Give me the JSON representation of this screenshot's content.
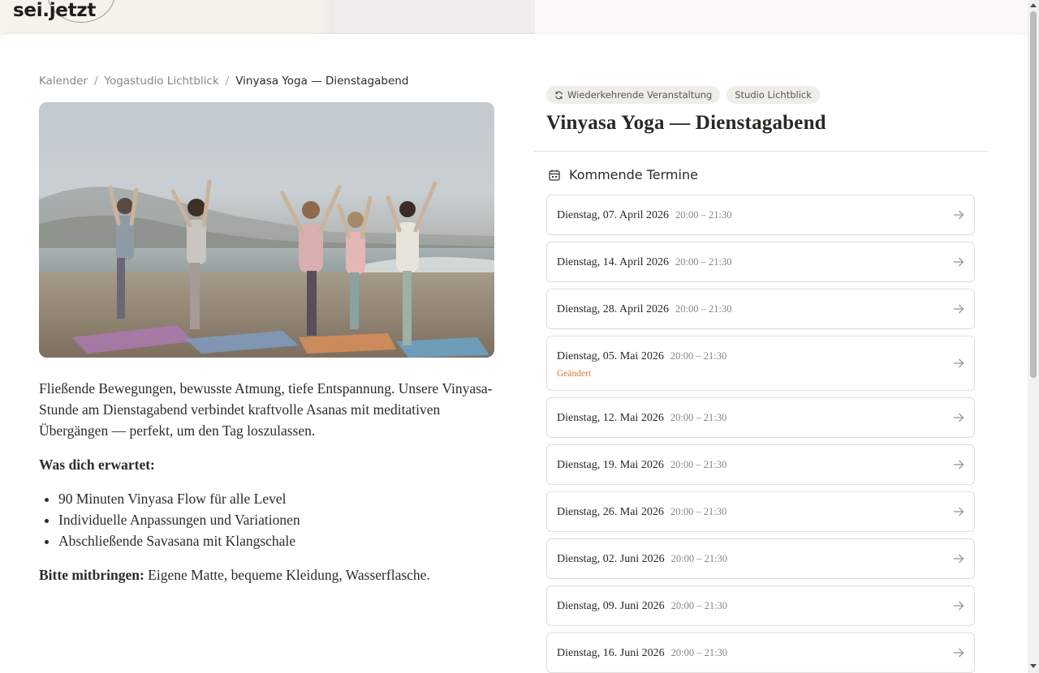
{
  "header": {
    "logo_text": "sei.jetzt"
  },
  "breadcrumb": {
    "items": [
      "Kalender",
      "Yogastudio Lichtblick",
      "Vinyasa Yoga — Dienstagabend"
    ],
    "separator": "/"
  },
  "event": {
    "chips": [
      "Wiederkehrende Veranstaltung",
      "Studio Lichtblick"
    ],
    "title": "Vinyasa Yoga — Dienstagabend",
    "upcoming_heading": "Kommende Termine",
    "changed_label": "Geändert",
    "dates": [
      {
        "day": "Dienstag, 07. April 2026",
        "time": "20:00 – 21:30",
        "changed": false
      },
      {
        "day": "Dienstag, 14. April 2026",
        "time": "20:00 – 21:30",
        "changed": false
      },
      {
        "day": "Dienstag, 28. April 2026",
        "time": "20:00 – 21:30",
        "changed": false
      },
      {
        "day": "Dienstag, 05. Mai 2026",
        "time": "20:00 – 21:30",
        "changed": true
      },
      {
        "day": "Dienstag, 12. Mai 2026",
        "time": "20:00 – 21:30",
        "changed": false
      },
      {
        "day": "Dienstag, 19. Mai 2026",
        "time": "20:00 – 21:30",
        "changed": false
      },
      {
        "day": "Dienstag, 26. Mai 2026",
        "time": "20:00 – 21:30",
        "changed": false
      },
      {
        "day": "Dienstag, 02. Juni 2026",
        "time": "20:00 – 21:30",
        "changed": false
      },
      {
        "day": "Dienstag, 09. Juni 2026",
        "time": "20:00 – 21:30",
        "changed": false
      },
      {
        "day": "Dienstag, 16. Juni 2026",
        "time": "20:00 – 21:30",
        "changed": false
      }
    ]
  },
  "description": {
    "intro": "Fließende Bewegungen, bewusste Atmung, tiefe Entspannung. Unsere Vinyasa-Stunde am Dienstagabend verbindet kraftvolle Asanas mit meditativen Übergängen — perfekt, um den Tag loszulassen.",
    "expect_heading": "Was dich erwartet:",
    "expect_items": [
      "90 Minuten Vinyasa Flow für alle Level",
      "Individuelle Anpassungen und Variationen",
      "Abschließende Savasana mit Klangschale"
    ],
    "bring_label": "Bitte mitbringen:",
    "bring_text": " Eigene Matte, bequeme Kleidung, Wasserflasche."
  },
  "icons": {
    "recurring": "refresh-icon",
    "calendar": "calendar-icon",
    "arrow": "arrow-right-icon"
  },
  "colors": {
    "accent_changed": "#d07a2a",
    "chip_bg": "#efede8",
    "border": "#e0ded9"
  }
}
